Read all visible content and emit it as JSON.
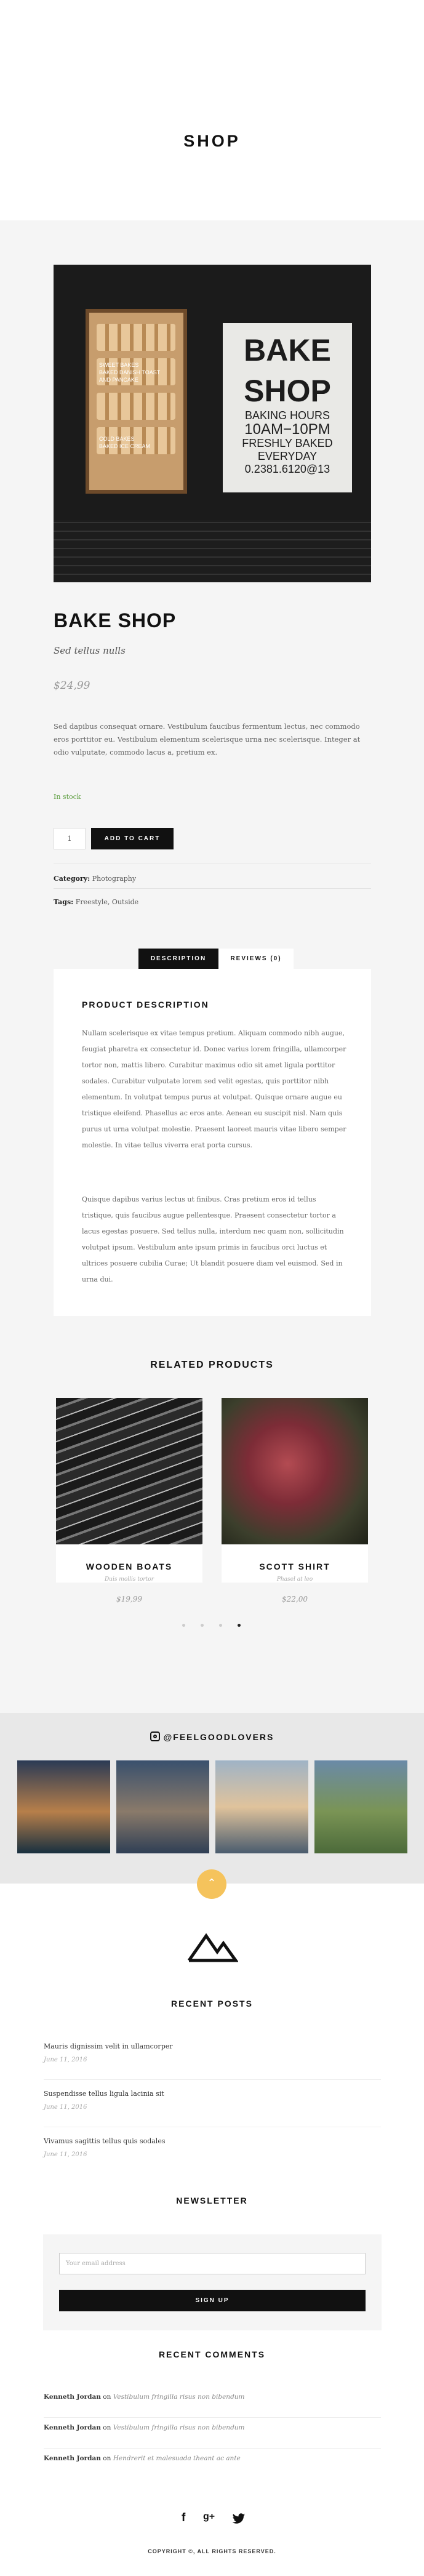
{
  "page": {
    "title": "SHOP"
  },
  "product": {
    "image_sign": {
      "line1": "BAKE",
      "line2": "SHOP",
      "l3": "BAKING HOURS",
      "l4": "10AM−10PM",
      "l5": "FRESHLY BAKED",
      "l6": "EVERYDAY",
      "l7": "0.2381.6120@13"
    },
    "window_labels": [
      "SWEET BAKES",
      "BAKED DANISH TOAST",
      "AND PANCAKE",
      "COLD BAKES",
      "BAKED ICE CREAM"
    ],
    "name": "BAKE SHOP",
    "subtitle": "Sed tellus nulls",
    "price": "$24,99",
    "description": "Sed dapibus consequat ornare. Vestibulum faucibus fermentum lectus, nec commodo eros porttitor eu. Vestibulum elementum scelerisque urna nec scelerisque. Integer at odio vulputate, commodo lacus a, pretium ex.",
    "stock": "In stock",
    "quantity": "1",
    "add_to_cart": "ADD TO CART",
    "category_label": "Category:",
    "category_value": "Photography",
    "tags_label": "Tags:",
    "tags_value": "Freestyle, Outside"
  },
  "tabs": {
    "description": "DESCRIPTION",
    "reviews": "REVIEWS (0)"
  },
  "desc_panel": {
    "heading": "PRODUCT DESCRIPTION",
    "p1": "Nullam scelerisque ex vitae tempus pretium. Aliquam commodo nibh augue, feugiat pharetra ex consectetur id. Donec varius lorem fringilla, ullamcorper tortor non, mattis libero. Curabitur maximus odio sit amet ligula porttitor sodales. Curabitur vulputate lorem sed velit egestas, quis porttitor nibh elementum. In volutpat tempus purus at volutpat. Quisque ornare augue eu tristique eleifend. Phasellus ac eros ante. Aenean eu suscipit nisl. Nam quis purus ut urna volutpat molestie. Praesent laoreet mauris vitae libero semper molestie. In vitae tellus viverra erat porta cursus.",
    "p2": "Quisque dapibus varius lectus ut finibus. Cras pretium eros id tellus tristique, quis faucibus augue pellentesque. Praesent consectetur tortor a lacus egestas posuere. Sed tellus nulla, interdum nec quam non, sollicitudin volutpat ipsum. Vestibulum ante ipsum primis in faucibus orci luctus et ultrices posuere cubilia Curae; Ut blandit posuere diam vel euismod. Sed in urna dui."
  },
  "related": {
    "heading": "RELATED PRODUCTS",
    "items": [
      {
        "title": "WOODEN BOATS",
        "category": "Duis mollis tortor",
        "price": "$19,99"
      },
      {
        "title": "SCOTT SHIRT",
        "category": "Phasel at leo",
        "price": "$22,00"
      }
    ]
  },
  "instagram": {
    "handle": "@FEELGOODLOVERS"
  },
  "scroll_top": "⌃",
  "recent_posts": {
    "heading": "RECENT POSTS",
    "items": [
      {
        "title": "Mauris dignissim velit in ullamcorper",
        "date": "June 11, 2016"
      },
      {
        "title": "Suspendisse tellus ligula lacinia sit",
        "date": "June 11, 2016"
      },
      {
        "title": "Vivamus sagittis tellus quis sodales",
        "date": "June 11, 2016"
      }
    ]
  },
  "newsletter": {
    "heading": "NEWSLETTER",
    "placeholder": "Your email address",
    "button": "SIGN UP"
  },
  "recent_comments": {
    "heading": "RECENT COMMENTS",
    "items": [
      {
        "author": "Kenneth Jordan",
        "on": "on",
        "post": "Vestibulum fringilla risus non bibendum"
      },
      {
        "author": "Kenneth Jordan",
        "on": "on",
        "post": "Vestibulum fringilla risus non bibendum"
      },
      {
        "author": "Kenneth Jordan",
        "on": "on",
        "post": "Hendrerit et malesuada theant ac ante"
      }
    ]
  },
  "footer": {
    "social": [
      "f",
      "g+",
      "twitter-bird"
    ],
    "copyright": "COPYRIGHT ©, ALL RIGHTS RESERVED."
  }
}
